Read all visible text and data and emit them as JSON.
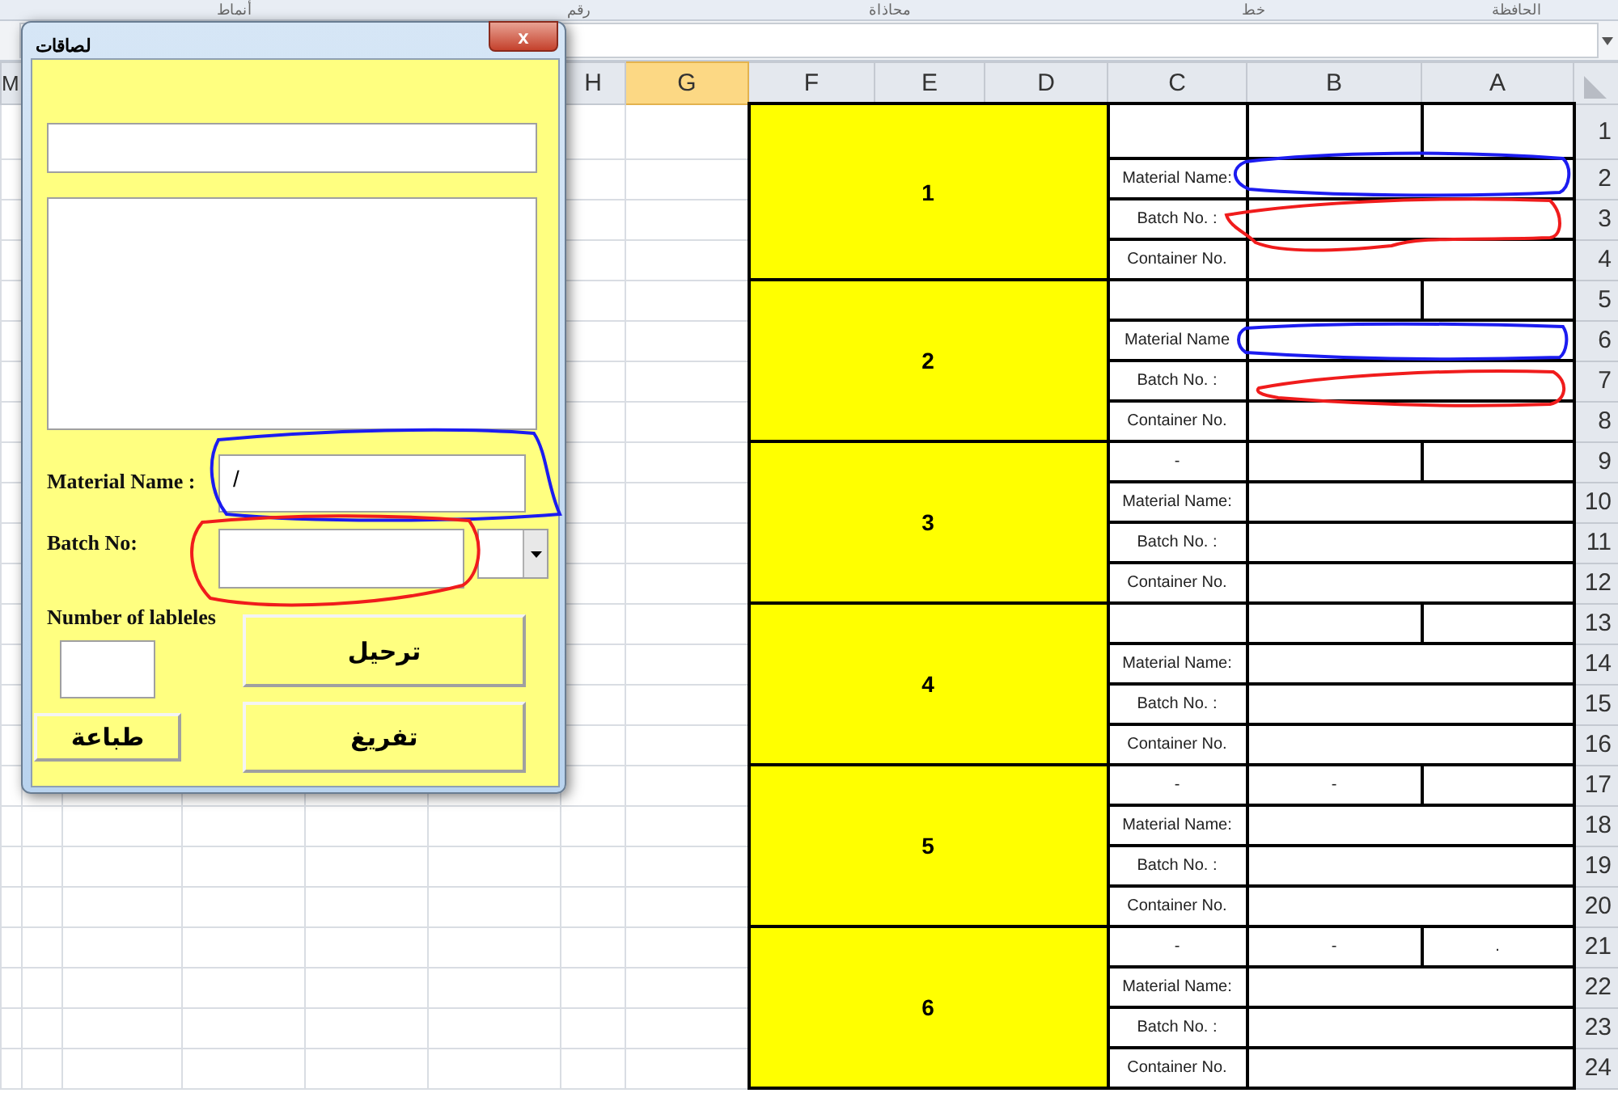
{
  "ribbon_groups": [
    "الحافظة",
    "خط",
    "محاذاة",
    "رقم",
    "أنماط"
  ],
  "column_headers": [
    {
      "label": "M",
      "selected": false
    },
    {
      "label": "H",
      "selected": false
    },
    {
      "label": "G",
      "selected": true
    },
    {
      "label": "F",
      "selected": false
    },
    {
      "label": "E",
      "selected": false
    },
    {
      "label": "D",
      "selected": false
    },
    {
      "label": "C",
      "selected": false
    },
    {
      "label": "B",
      "selected": false
    },
    {
      "label": "A",
      "selected": false
    }
  ],
  "groups": [
    {
      "number": "1",
      "top_row": "1",
      "rows": [
        {
          "row": "2",
          "label": "Material Name:"
        },
        {
          "row": "3",
          "label": "Batch No. :"
        },
        {
          "row": "4",
          "label": "Container No."
        }
      ]
    },
    {
      "number": "2",
      "top_row": "5",
      "rows": [
        {
          "row": "6",
          "label": "Material Name"
        },
        {
          "row": "7",
          "label": "Batch No. :"
        },
        {
          "row": "8",
          "label": "Container No."
        }
      ]
    },
    {
      "number": "3",
      "top_row": "9",
      "top_cells": {
        "c": "-"
      },
      "rows": [
        {
          "row": "10",
          "label": "Material Name:"
        },
        {
          "row": "11",
          "label": "Batch No. :"
        },
        {
          "row": "12",
          "label": "Container No."
        }
      ]
    },
    {
      "number": "4",
      "top_row": "13",
      "rows": [
        {
          "row": "14",
          "label": "Material Name:"
        },
        {
          "row": "15",
          "label": "Batch No. :"
        },
        {
          "row": "16",
          "label": "Container No."
        }
      ]
    },
    {
      "number": "5",
      "top_row": "17",
      "top_cells": {
        "c": "-",
        "b": "-"
      },
      "rows": [
        {
          "row": "18",
          "label": "Material Name:"
        },
        {
          "row": "19",
          "label": "Batch No. :"
        },
        {
          "row": "20",
          "label": "Container No."
        }
      ]
    },
    {
      "number": "6",
      "top_row": "21",
      "top_cells": {
        "c": "-",
        "b": "-",
        "a": "."
      },
      "rows": [
        {
          "row": "22",
          "label": "Material Name:"
        },
        {
          "row": "23",
          "label": "Batch No. :"
        },
        {
          "row": "24",
          "label": "Container No."
        }
      ]
    }
  ],
  "dialog": {
    "title": "لصاقات",
    "close": "x",
    "material_name": {
      "label": "Material Name :",
      "value": "/"
    },
    "batch_no": {
      "label": "Batch No:"
    },
    "labels_count": {
      "label": "Number of lableles"
    },
    "buttons": [
      {
        "kind": "post",
        "label": "ترحيل"
      },
      {
        "kind": "print",
        "label": "طباعة"
      },
      {
        "kind": "clear",
        "label": "تفريغ"
      }
    ]
  },
  "scribbles": [
    {
      "color": "#1c1cf0"
    },
    {
      "color": "#f01c1c"
    },
    {
      "color": "#1c1cf0"
    },
    {
      "color": "#f01c1c"
    },
    {
      "color": "#1c1cf0"
    },
    {
      "color": "#f01c1c"
    }
  ]
}
